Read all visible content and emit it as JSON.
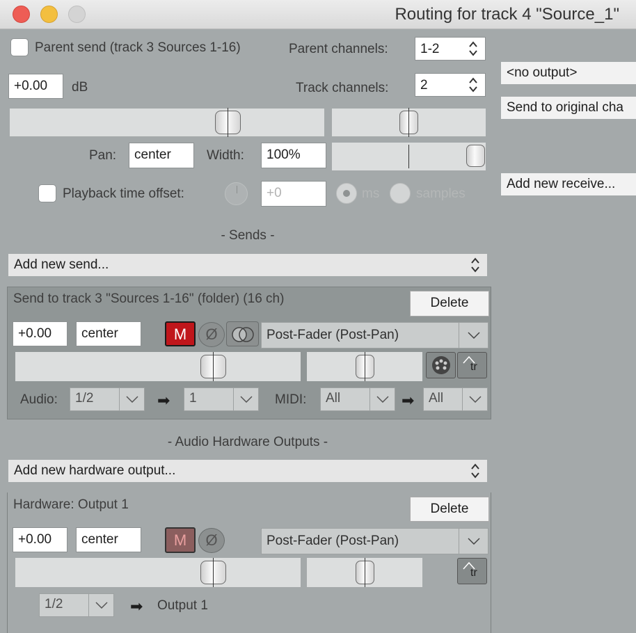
{
  "window": {
    "title": "Routing for track 4 \"Source_1\"",
    "traffic_lights": [
      "#ee5d55",
      "#f3bf3f",
      "#d4d4d4"
    ]
  },
  "parent": {
    "send_label": "Parent send (track 3 Sources 1-16)",
    "channels_label": "Parent channels:",
    "channels_value": "1-2",
    "volume_value": "+0.00",
    "volume_unit": "dB",
    "track_channels_label": "Track channels:",
    "track_channels_value": "2",
    "pan_label": "Pan:",
    "pan_value": "center",
    "width_label": "Width:",
    "width_value": "100%",
    "offset_label": "Playback time offset:",
    "offset_value": "+0",
    "unit_ms": "ms",
    "unit_samples": "samples"
  },
  "sends": {
    "header": "-  Sends  -",
    "add_label": "Add new send...",
    "item": {
      "title": "Send to track 3 \"Sources 1-16\" (folder) (16 ch)",
      "delete_label": "Delete",
      "volume": "+0.00",
      "pan": "center",
      "mute_label": "M",
      "phase_label": "Ø",
      "mode": "Post-Fader (Post-Pan)",
      "audio_label": "Audio:",
      "audio_src": "1/2",
      "audio_dst": "1",
      "midi_label": "MIDI:",
      "midi_src": "All",
      "midi_dst": "All",
      "env_label": "tr"
    }
  },
  "hardware": {
    "header": "-  Audio Hardware Outputs  -",
    "add_label": "Add new hardware output...",
    "item": {
      "title": "Hardware: Output 1",
      "delete_label": "Delete",
      "volume": "+0.00",
      "pan": "center",
      "mute_label": "M",
      "phase_label": "Ø",
      "mode": "Post-Fader (Post-Pan)",
      "channel": "1/2",
      "output": "Output 1",
      "env_label": "tr"
    }
  },
  "receives": {
    "no_output": "<no output>",
    "send_original": "Send to original cha",
    "add_label": "Add new receive..."
  },
  "icons": {
    "arrow": "➡",
    "chevron": "⌵",
    "phase": "Ø"
  },
  "colors": {
    "mute_active": "#c0161b",
    "mute_inactive": "#8b5e5e"
  }
}
